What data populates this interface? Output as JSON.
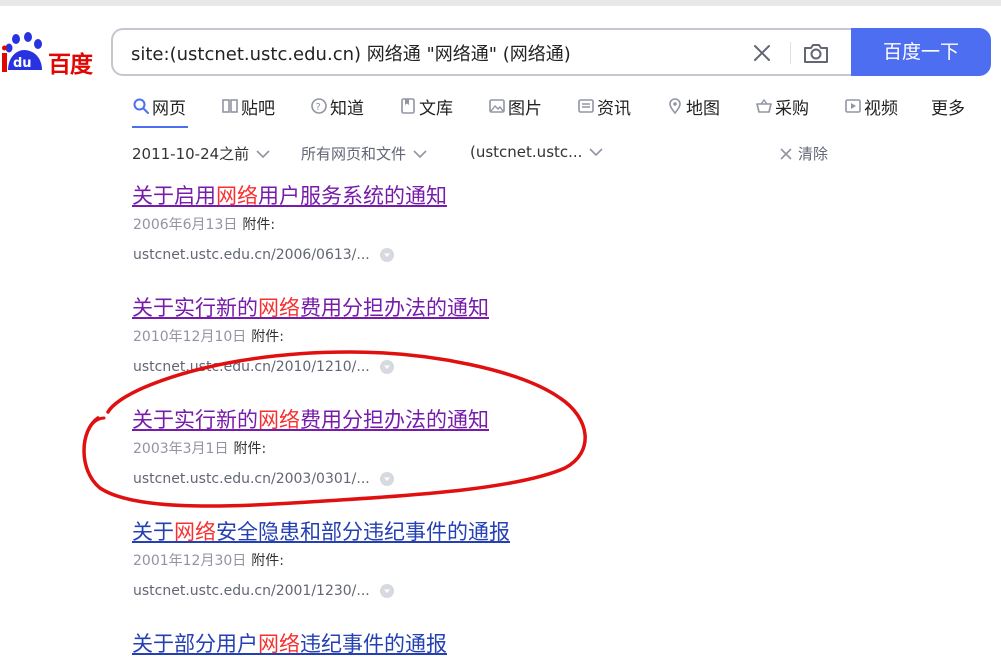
{
  "logo": {
    "text": "百度",
    "du": "du"
  },
  "search": {
    "value": "site:(ustcnet.ustc.edu.cn) 网络通 \"网络通\" (网络通)",
    "button_label": "百度一下"
  },
  "tabs": [
    {
      "label": "网页",
      "icon": "search-icon"
    },
    {
      "label": "贴吧",
      "icon": "tieba-icon"
    },
    {
      "label": "知道",
      "icon": "question-icon"
    },
    {
      "label": "文库",
      "icon": "document-icon"
    },
    {
      "label": "图片",
      "icon": "image-icon"
    },
    {
      "label": "资讯",
      "icon": "news-icon"
    },
    {
      "label": "地图",
      "icon": "map-pin-icon"
    },
    {
      "label": "采购",
      "icon": "basket-icon"
    },
    {
      "label": "视频",
      "icon": "play-icon"
    },
    {
      "label": "更多",
      "icon": ""
    }
  ],
  "filters": {
    "time": "2011-10-24之前",
    "type": "所有网页和文件",
    "site": "(ustcnet.ustc...",
    "clear": "清除"
  },
  "results": [
    {
      "title_pre": "关于启用",
      "title_hl": "网络",
      "title_post": "用户服务系统的通知",
      "date": "2006年6月13日",
      "attach": "附件:",
      "url": "ustcnet.ustc.edu.cn/2006/0613/...",
      "visited": true
    },
    {
      "title_pre": "关于实行新的",
      "title_hl": "网络",
      "title_post": "费用分担办法的通知",
      "date": "2010年12月10日",
      "attach": "附件:",
      "url": "ustcnet.ustc.edu.cn/2010/1210/...",
      "visited": true
    },
    {
      "title_pre": "关于实行新的",
      "title_hl": "网络",
      "title_post": "费用分担办法的通知",
      "date": "2003年3月1日",
      "attach": "附件:",
      "url": "ustcnet.ustc.edu.cn/2003/0301/...",
      "visited": true
    },
    {
      "title_pre": "关于",
      "title_hl": "网络",
      "title_post": "安全隐患和部分违纪事件的通报",
      "date": "2001年12月30日",
      "attach": "附件:",
      "url": "ustcnet.ustc.edu.cn/2001/1230/...",
      "visited": false
    },
    {
      "title_pre": "关于部分用户",
      "title_hl": "网络",
      "title_post": "违纪事件的通报",
      "date": "",
      "attach": "",
      "url": "",
      "visited": false
    }
  ],
  "colors": {
    "accent": "#4e6ef2",
    "highlight": "#f73131",
    "visited": "#771caa",
    "link": "#2440b3",
    "annotation": "#e01010"
  }
}
